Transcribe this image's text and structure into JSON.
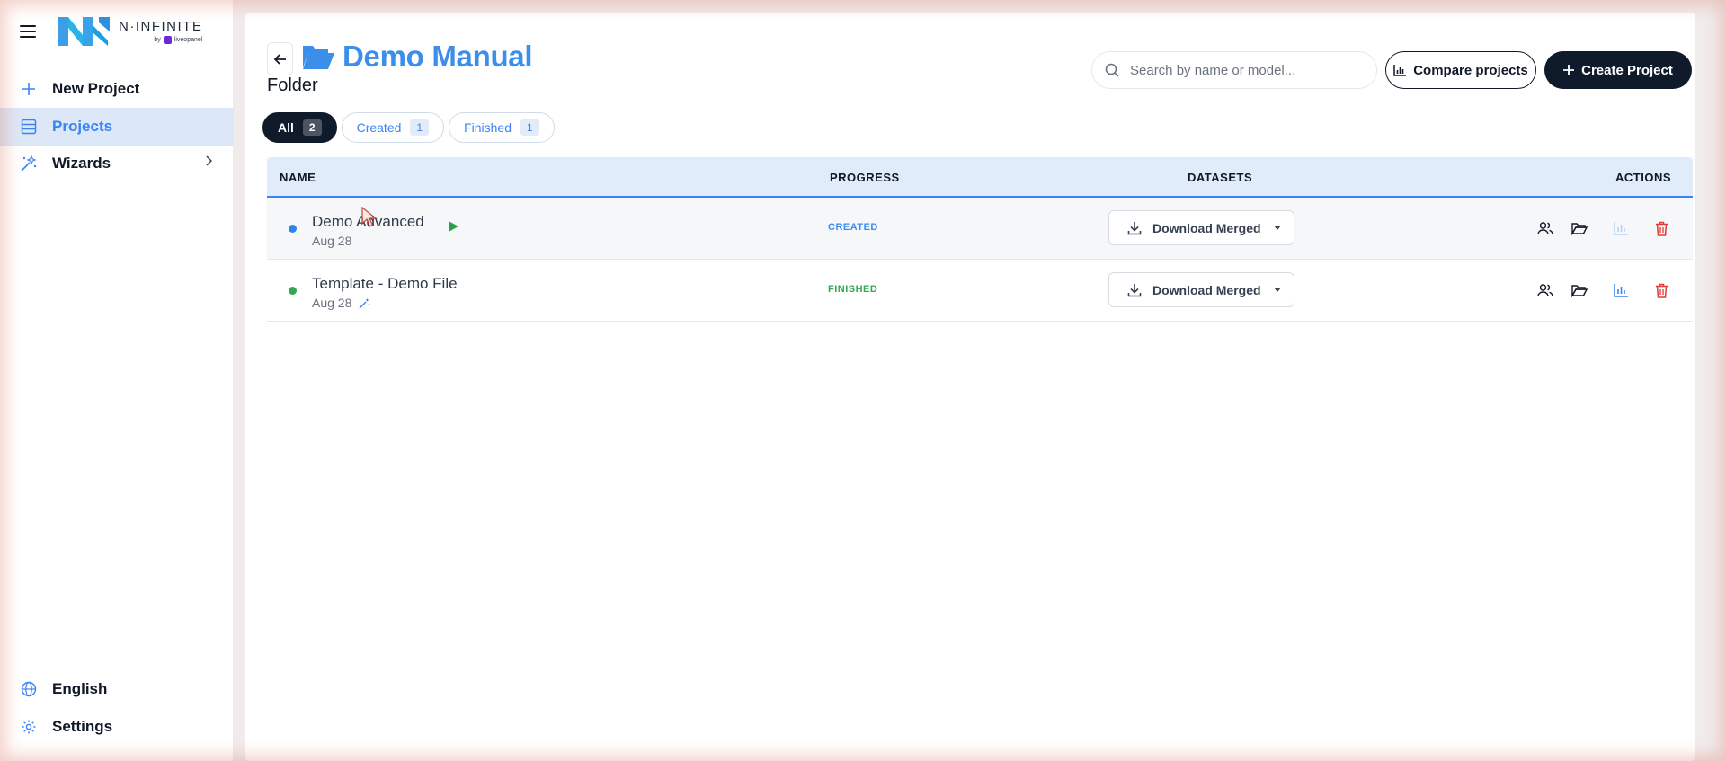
{
  "sidebar": {
    "logo": {
      "name": "N·INFINITE",
      "by": "by",
      "brand": "liveopanel"
    },
    "items": [
      {
        "label": "New Project",
        "icon": "plus-icon"
      },
      {
        "label": "Projects",
        "icon": "table-icon",
        "active": true
      },
      {
        "label": "Wizards",
        "icon": "sparkles-icon"
      }
    ],
    "bottom": [
      {
        "label": "English",
        "icon": "globe-icon"
      },
      {
        "label": "Settings",
        "icon": "gear-icon"
      }
    ]
  },
  "header": {
    "title": "Demo Manual",
    "subtitle": "Folder",
    "search_placeholder": "Search by name or model...",
    "compare_label": "Compare projects",
    "create_label": "Create Project"
  },
  "filters": [
    {
      "label": "All",
      "count": "2",
      "active": true
    },
    {
      "label": "Created",
      "count": "1"
    },
    {
      "label": "Finished",
      "count": "1"
    }
  ],
  "table": {
    "columns": {
      "name": "NAME",
      "progress": "PROGRESS",
      "datasets": "DATASETS",
      "actions": "ACTIONS"
    },
    "rows": [
      {
        "name": "Demo Advanced",
        "date": "Aug 28",
        "status": "CREATED",
        "status_color": "#3b8eea",
        "dot_color": "#2f86e6",
        "download_label": "Download Merged"
      },
      {
        "name": "Template - Demo File",
        "date": "Aug 28",
        "status": "FINISHED",
        "status_color": "#34a853",
        "dot_color": "#34a853",
        "download_label": "Download Merged"
      }
    ]
  },
  "colors": {
    "accent": "#3b8eea",
    "dark": "#0f1a2a",
    "danger": "#e53935"
  }
}
